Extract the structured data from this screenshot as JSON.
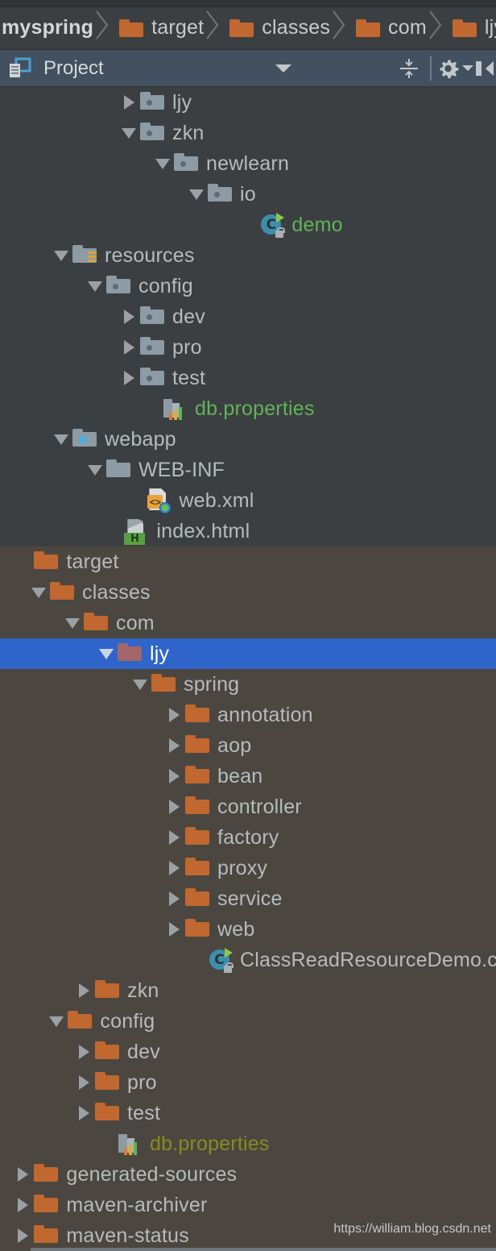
{
  "breadcrumb": {
    "items": [
      {
        "label": "myspring",
        "icon": null,
        "bold": true
      },
      {
        "label": "target",
        "icon": "folder-icon",
        "bold": false
      },
      {
        "label": "classes",
        "icon": "folder-icon",
        "bold": false
      },
      {
        "label": "com",
        "icon": "folder-icon",
        "bold": false
      },
      {
        "label": "ljy",
        "icon": "folder-icon",
        "bold": false
      }
    ]
  },
  "toolbar": {
    "title": "Project",
    "view_dropdown_icon": "chevron-down-icon",
    "panel_icon": "project-panel-icon",
    "collapse_all_icon": "collapse-all-icon",
    "settings_icon": "gear-icon",
    "settings_dropdown_icon": "chevron-down-icon",
    "hide_icon": "hide-panel-icon"
  },
  "colors": {
    "background_dark": "#3c3f41",
    "background_excluded": "#4b4740",
    "selection": "#2f65ca",
    "folder_orange": "#c0682f",
    "folder_grey": "#8d9ba5",
    "text": "#b6bbbd",
    "green_file": "#62b25a",
    "olive_file": "#8a8a20",
    "toolbar": "#43505f"
  },
  "tree": {
    "rows": [
      {
        "name": "ljy",
        "indent": 5,
        "arrow": "right",
        "icon": "package-folder-icon",
        "color": "default",
        "bg": "dark"
      },
      {
        "name": "zkn",
        "indent": 5,
        "arrow": "down",
        "icon": "package-folder-icon",
        "color": "default",
        "bg": "dark"
      },
      {
        "name": "newlearn",
        "indent": 6.5,
        "arrow": "down",
        "icon": "package-folder-icon",
        "color": "default",
        "bg": "dark"
      },
      {
        "name": "io",
        "indent": 8,
        "arrow": "down",
        "icon": "package-folder-icon",
        "color": "default",
        "bg": "dark"
      },
      {
        "name": "demo",
        "indent": 10.3,
        "arrow": "none",
        "icon": "java-class-icon",
        "color": "green",
        "bg": "dark"
      },
      {
        "name": "resources",
        "indent": 2,
        "arrow": "down",
        "icon": "resources-folder-icon",
        "color": "default",
        "bg": "dark"
      },
      {
        "name": "config",
        "indent": 3.5,
        "arrow": "down",
        "icon": "package-folder-icon",
        "color": "default",
        "bg": "dark"
      },
      {
        "name": "dev",
        "indent": 5,
        "arrow": "right",
        "icon": "package-folder-icon",
        "color": "default",
        "bg": "dark"
      },
      {
        "name": "pro",
        "indent": 5,
        "arrow": "right",
        "icon": "package-folder-icon",
        "color": "default",
        "bg": "dark"
      },
      {
        "name": "test",
        "indent": 5,
        "arrow": "right",
        "icon": "package-folder-icon",
        "color": "default",
        "bg": "dark"
      },
      {
        "name": "db.properties",
        "indent": 6,
        "arrow": "none",
        "icon": "properties-file-icon",
        "color": "green",
        "bg": "dark"
      },
      {
        "name": "webapp",
        "indent": 2,
        "arrow": "down",
        "icon": "webapp-folder-icon",
        "color": "default",
        "bg": "dark"
      },
      {
        "name": "WEB-INF",
        "indent": 3.5,
        "arrow": "down",
        "icon": "plain-folder-icon",
        "color": "default",
        "bg": "dark"
      },
      {
        "name": "web.xml",
        "indent": 5.3,
        "arrow": "none",
        "icon": "xml-file-icon",
        "color": "default",
        "bg": "dark"
      },
      {
        "name": "index.html",
        "indent": 4.3,
        "arrow": "none",
        "icon": "html-file-icon",
        "color": "default",
        "bg": "dark"
      },
      {
        "name": "target",
        "indent": 0.3,
        "arrow": "none",
        "icon": "folder-icon",
        "color": "default",
        "bg": "brown"
      },
      {
        "name": "classes",
        "indent": 1,
        "arrow": "down",
        "icon": "folder-icon",
        "color": "default",
        "bg": "brown"
      },
      {
        "name": "com",
        "indent": 2.5,
        "arrow": "down",
        "icon": "folder-icon",
        "color": "default",
        "bg": "brown"
      },
      {
        "name": "ljy",
        "indent": 4,
        "arrow": "down",
        "icon": "folder-icon",
        "color": "default",
        "bg": "selected"
      },
      {
        "name": "spring",
        "indent": 5.5,
        "arrow": "down",
        "icon": "folder-icon",
        "color": "default",
        "bg": "brown"
      },
      {
        "name": "annotation",
        "indent": 7,
        "arrow": "right",
        "icon": "folder-icon",
        "color": "default",
        "bg": "brown"
      },
      {
        "name": "aop",
        "indent": 7,
        "arrow": "right",
        "icon": "folder-icon",
        "color": "default",
        "bg": "brown"
      },
      {
        "name": "bean",
        "indent": 7,
        "arrow": "right",
        "icon": "folder-icon",
        "color": "default",
        "bg": "brown"
      },
      {
        "name": "controller",
        "indent": 7,
        "arrow": "right",
        "icon": "folder-icon",
        "color": "default",
        "bg": "brown"
      },
      {
        "name": "factory",
        "indent": 7,
        "arrow": "right",
        "icon": "folder-icon",
        "color": "default",
        "bg": "brown"
      },
      {
        "name": "proxy",
        "indent": 7,
        "arrow": "right",
        "icon": "folder-icon",
        "color": "default",
        "bg": "brown"
      },
      {
        "name": "service",
        "indent": 7,
        "arrow": "right",
        "icon": "folder-icon",
        "color": "default",
        "bg": "brown"
      },
      {
        "name": "web",
        "indent": 7,
        "arrow": "right",
        "icon": "folder-icon",
        "color": "default",
        "bg": "brown"
      },
      {
        "name": "ClassReadResourceDemo.clas",
        "indent": 8,
        "arrow": "none",
        "icon": "java-class-icon",
        "color": "default",
        "bg": "brown"
      },
      {
        "name": "zkn",
        "indent": 3,
        "arrow": "right",
        "icon": "folder-icon",
        "color": "default",
        "bg": "brown"
      },
      {
        "name": "config",
        "indent": 1.8,
        "arrow": "down",
        "icon": "folder-icon",
        "color": "default",
        "bg": "brown"
      },
      {
        "name": "dev",
        "indent": 3,
        "arrow": "right",
        "icon": "folder-icon",
        "color": "default",
        "bg": "brown"
      },
      {
        "name": "pro",
        "indent": 3,
        "arrow": "right",
        "icon": "folder-icon",
        "color": "default",
        "bg": "brown"
      },
      {
        "name": "test",
        "indent": 3,
        "arrow": "right",
        "icon": "folder-icon",
        "color": "default",
        "bg": "brown"
      },
      {
        "name": "db.properties",
        "indent": 4,
        "arrow": "none",
        "icon": "properties-file-icon",
        "color": "olive",
        "bg": "brown"
      },
      {
        "name": "generated-sources",
        "indent": 0.3,
        "arrow": "right",
        "icon": "folder-icon",
        "color": "default",
        "bg": "brown"
      },
      {
        "name": "maven-archiver",
        "indent": 0.3,
        "arrow": "right",
        "icon": "folder-icon",
        "color": "default",
        "bg": "brown"
      },
      {
        "name": "maven-status",
        "indent": 0.3,
        "arrow": "right",
        "icon": "folder-icon",
        "color": "default",
        "bg": "brown"
      }
    ]
  },
  "watermark": "https://william.blog.csdn.net"
}
